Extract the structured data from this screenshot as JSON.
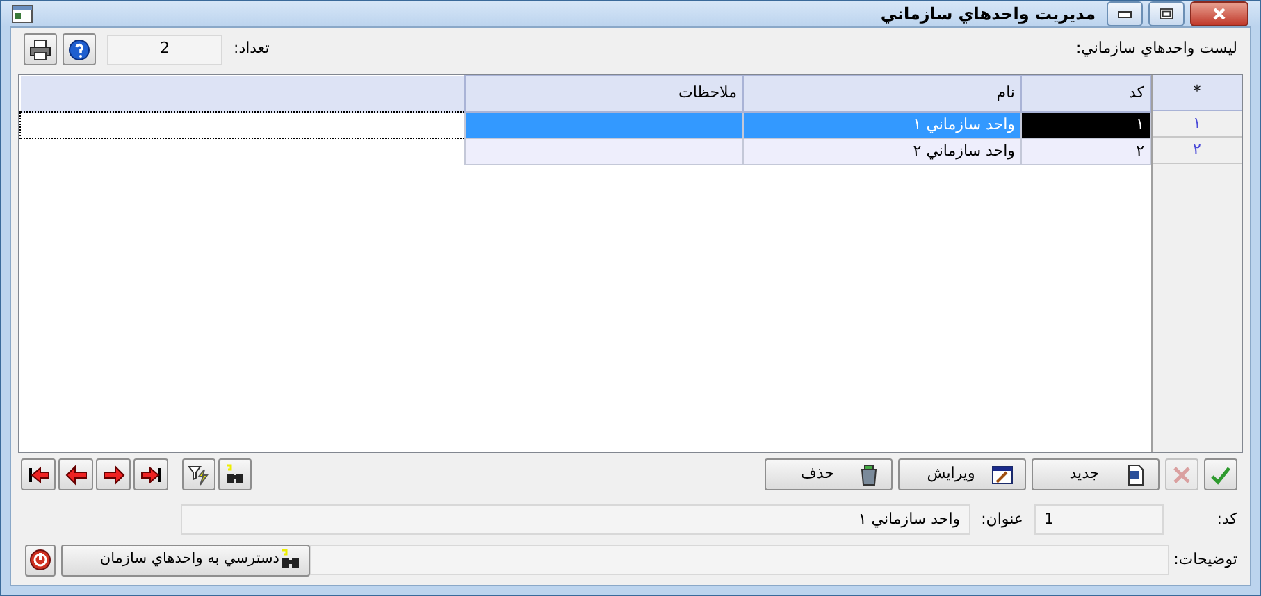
{
  "window": {
    "title": "مديريت واحدهاي سازماني"
  },
  "top_bar": {
    "count_label": "تعداد:",
    "count": "2",
    "list_label": "ليست واحدهاي سازماني:"
  },
  "table": {
    "columns": [
      {
        "label": "*"
      },
      {
        "label": "کد"
      },
      {
        "label": "نام"
      },
      {
        "label": "ملاحظات"
      }
    ],
    "rows": [
      {
        "row_number": "۱",
        "code": "۱",
        "name": "واحد سازماني ۱",
        "selected": true
      },
      {
        "row_number": "۲",
        "code": "۲",
        "name": "واحد سازماني ۲",
        "selected": false
      }
    ]
  },
  "actions": [
    {
      "kind": "confirm",
      "disabled": false
    },
    {
      "kind": "cancel",
      "disabled": true
    },
    {
      "kind": "new",
      "label": "جديد",
      "disabled": false
    },
    {
      "kind": "edit",
      "label": "ويرايش",
      "disabled": false
    },
    {
      "kind": "delete",
      "label": "حذف",
      "disabled": false
    }
  ],
  "navigation": [
    {
      "kind": "first"
    },
    {
      "kind": "previous"
    },
    {
      "kind": "next"
    },
    {
      "kind": "last"
    },
    {
      "kind": "filter"
    },
    {
      "kind": "find"
    }
  ],
  "form": {
    "code_label": "کد:",
    "code": "1",
    "title_label": "عنوان:",
    "title": "واحد سازماني ۱",
    "notes_label": "توضيحات:"
  },
  "access_button": {
    "label": "دسترسي به واحدهاي سازمان"
  }
}
